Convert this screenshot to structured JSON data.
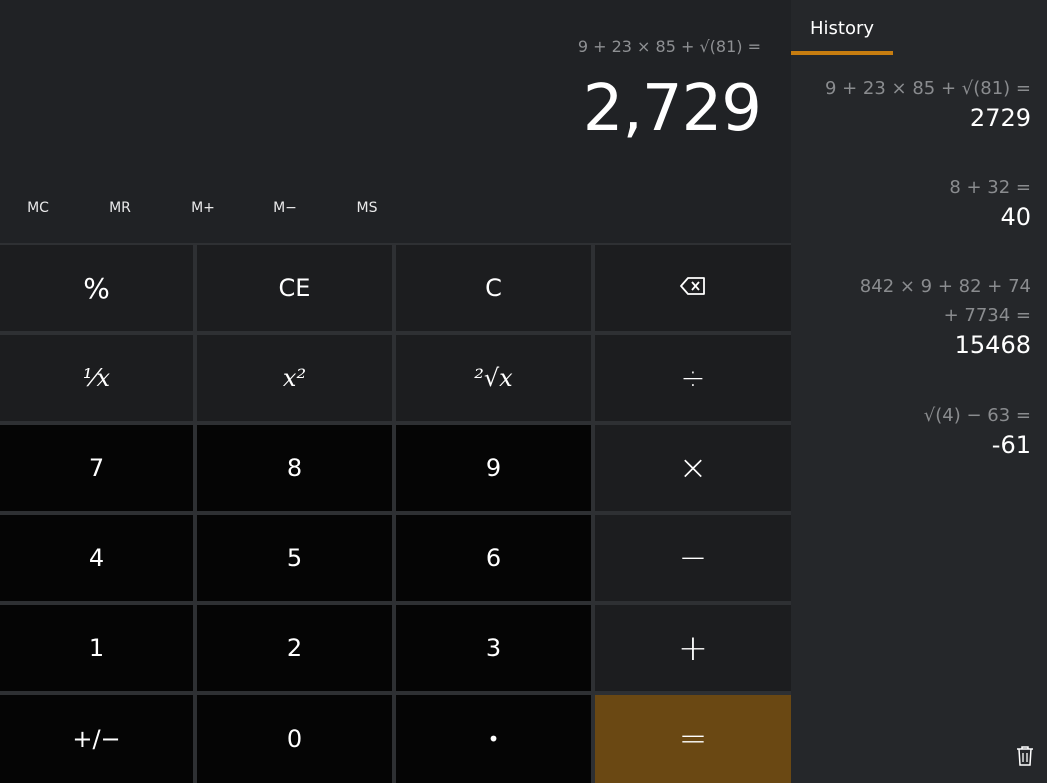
{
  "display": {
    "expression": "9 + 23 × 85 + √(81) =",
    "result": "2,729"
  },
  "memory": {
    "mc": "MC",
    "mr": "MR",
    "m_plus": "M+",
    "m_minus": "M−",
    "ms": "MS"
  },
  "keys": {
    "percent": "%",
    "ce": "CE",
    "c": "C",
    "backspace_icon": "backspace-icon",
    "reciprocal": "⅟x",
    "square": "x²",
    "sqrt": "²√x",
    "divide": "÷",
    "seven": "7",
    "eight": "8",
    "nine": "9",
    "multiply": "×",
    "four": "4",
    "five": "5",
    "six": "6",
    "minus": "−",
    "one": "1",
    "two": "2",
    "three": "3",
    "plus": "+",
    "negate": "+/−",
    "zero": "0",
    "decimal": "•",
    "equals": "="
  },
  "history": {
    "tab_label": "History",
    "entries": [
      {
        "expression": "9 + 23 × 85 + √(81) =",
        "result": "2729"
      },
      {
        "expression": "8 + 32 =",
        "result": "40"
      },
      {
        "expression": "842 × 9 + 82 + 74 + 7734 =",
        "result": "15468"
      },
      {
        "expression": "√(4) − 63 =",
        "result": "-61"
      }
    ],
    "clear_icon": "trash-icon"
  },
  "colors": {
    "accent": "#c77d10",
    "equals_key": "#6a4813",
    "background": "#202225",
    "number_key": "#050505",
    "function_key": "#1c1d1f"
  }
}
